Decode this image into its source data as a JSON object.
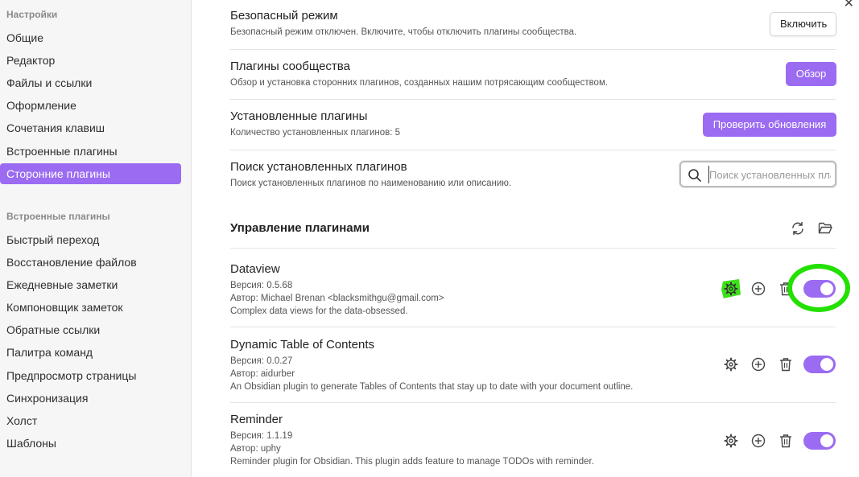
{
  "sidebar": {
    "header1": "Настройки",
    "options": [
      "Общие",
      "Редактор",
      "Файлы и ссылки",
      "Оформление",
      "Сочетания клавиш",
      "Встроенные плагины",
      "Сторонние плагины"
    ],
    "header2": "Встроенные плагины",
    "core_plugins": [
      "Быстрый переход",
      "Восстановление файлов",
      "Ежедневные заметки",
      "Компоновщик заметок",
      "Обратные ссылки",
      "Палитра команд",
      "Предпросмотр страницы",
      "Синхронизация",
      "Холст",
      "Шаблоны"
    ]
  },
  "settings": {
    "safe_mode": {
      "title": "Безопасный режим",
      "desc": "Безопасный режим отключен. Включите, чтобы отключить плагины сообщества.",
      "button": "Включить"
    },
    "community": {
      "title": "Плагины сообщества",
      "desc": "Обзор и установка сторонних плагинов, созданных нашим потрясающим сообществом.",
      "button": "Обзор"
    },
    "installed": {
      "title": "Установленные плагины",
      "desc": "Количество установленных плагинов: 5",
      "button": "Проверить обновления"
    },
    "search": {
      "title": "Поиск установленных плагинов",
      "desc": "Поиск установленных плагинов по наименованию или описанию.",
      "placeholder": "Поиск установленных плагинов"
    }
  },
  "manage": {
    "title": "Управление плагинами"
  },
  "plugins": [
    {
      "name": "Dataview",
      "version": "Версия: 0.5.68",
      "author": "Автор: Michael Brenan <blacksmithgu@gmail.com>",
      "desc": "Complex data views for the data-obsessed.",
      "enabled": true
    },
    {
      "name": "Dynamic Table of Contents",
      "version": "Версия: 0.0.27",
      "author": "Автор: aidurber",
      "desc": "An Obsidian plugin to generate Tables of Contents that stay up to date with your document outline.",
      "enabled": true
    },
    {
      "name": "Reminder",
      "version": "Версия: 1.1.19",
      "author": "Автор: uphy",
      "desc": "Reminder plugin for Obsidian. This plugin adds feature to manage TODOs with reminder.",
      "enabled": true
    }
  ],
  "colors": {
    "accent": "#9b6bf2",
    "annotation": "#22e000"
  },
  "icons": [
    "search-icon",
    "refresh-icon",
    "folder-icon",
    "gear-icon",
    "plus-circle-icon",
    "trash-icon",
    "close-icon"
  ]
}
